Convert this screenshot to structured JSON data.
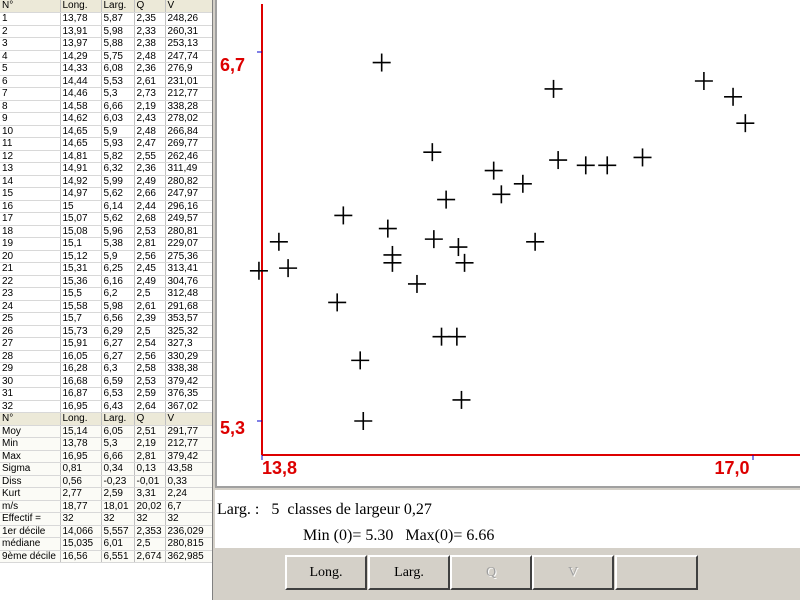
{
  "table": {
    "headers": [
      "N°",
      "Long.",
      "Larg.",
      "Q",
      "V"
    ],
    "rows": [
      [
        "1",
        "13,78",
        "5,87",
        "2,35",
        "248,26"
      ],
      [
        "2",
        "13,91",
        "5,98",
        "2,33",
        "260,31"
      ],
      [
        "3",
        "13,97",
        "5,88",
        "2,38",
        "253,13"
      ],
      [
        "4",
        "14,29",
        "5,75",
        "2,48",
        "247,74"
      ],
      [
        "5",
        "14,33",
        "6,08",
        "2,36",
        "276,9"
      ],
      [
        "6",
        "14,44",
        "5,53",
        "2,61",
        "231,01"
      ],
      [
        "7",
        "14,46",
        "5,3",
        "2,73",
        "212,77"
      ],
      [
        "8",
        "14,58",
        "6,66",
        "2,19",
        "338,28"
      ],
      [
        "9",
        "14,62",
        "6,03",
        "2,43",
        "278,02"
      ],
      [
        "10",
        "14,65",
        "5,9",
        "2,48",
        "266,84"
      ],
      [
        "11",
        "14,65",
        "5,93",
        "2,47",
        "269,77"
      ],
      [
        "12",
        "14,81",
        "5,82",
        "2,55",
        "262,46"
      ],
      [
        "13",
        "14,91",
        "6,32",
        "2,36",
        "311,49"
      ],
      [
        "14",
        "14,92",
        "5,99",
        "2,49",
        "280,82"
      ],
      [
        "15",
        "14,97",
        "5,62",
        "2,66",
        "247,97"
      ],
      [
        "16",
        "15",
        "6,14",
        "2,44",
        "296,16"
      ],
      [
        "17",
        "15,07",
        "5,62",
        "2,68",
        "249,57"
      ],
      [
        "18",
        "15,08",
        "5,96",
        "2,53",
        "280,81"
      ],
      [
        "19",
        "15,1",
        "5,38",
        "2,81",
        "229,07"
      ],
      [
        "20",
        "15,12",
        "5,9",
        "2,56",
        "275,36"
      ],
      [
        "21",
        "15,31",
        "6,25",
        "2,45",
        "313,41"
      ],
      [
        "22",
        "15,36",
        "6,16",
        "2,49",
        "304,76"
      ],
      [
        "23",
        "15,5",
        "6,2",
        "2,5",
        "312,48"
      ],
      [
        "24",
        "15,58",
        "5,98",
        "2,61",
        "291,68"
      ],
      [
        "25",
        "15,7",
        "6,56",
        "2,39",
        "353,57"
      ],
      [
        "26",
        "15,73",
        "6,29",
        "2,5",
        "325,32"
      ],
      [
        "27",
        "15,91",
        "6,27",
        "2,54",
        "327,3"
      ],
      [
        "28",
        "16,05",
        "6,27",
        "2,56",
        "330,29"
      ],
      [
        "29",
        "16,28",
        "6,3",
        "2,58",
        "338,38"
      ],
      [
        "30",
        "16,68",
        "6,59",
        "2,53",
        "379,42"
      ],
      [
        "31",
        "16,87",
        "6,53",
        "2,59",
        "376,35"
      ],
      [
        "32",
        "16,95",
        "6,43",
        "2,64",
        "367,02"
      ]
    ],
    "stats": [
      [
        "Moy",
        "15,14",
        "6,05",
        "2,51",
        "291,77"
      ],
      [
        "Min",
        "13,78",
        "5,3",
        "2,19",
        "212,77"
      ],
      [
        "Max",
        "16,95",
        "6,66",
        "2,81",
        "379,42"
      ],
      [
        "Sigma",
        "0,81",
        "0,34",
        "0,13",
        "43,58"
      ],
      [
        "Diss",
        "0,56",
        "-0,23",
        "-0,01",
        "0,33"
      ],
      [
        "Kurt",
        "2,77",
        "2,59",
        "3,31",
        "2,24"
      ],
      [
        "m/s",
        "18,77",
        "18,01",
        "20,02",
        "6,7"
      ],
      [
        "Effectif =",
        "32",
        "32",
        "32",
        "32"
      ],
      [
        "1er décile",
        "14,066",
        "5,557",
        "2,353",
        "236,029"
      ],
      [
        "médiane",
        "15,035",
        "6,01",
        "2,5",
        "280,815"
      ],
      [
        "9ème décile",
        "16,56",
        "6,551",
        "2,674",
        "362,985"
      ]
    ]
  },
  "chart_data": {
    "type": "scatter",
    "x_tick_labels": [
      "13,8",
      "17,0"
    ],
    "y_tick_labels": [
      "6,7",
      "5,3"
    ],
    "xlim": [
      13.8,
      17.0
    ],
    "ylim": [
      5.3,
      6.7
    ],
    "points": [
      [
        13.78,
        5.87
      ],
      [
        13.91,
        5.98
      ],
      [
        13.97,
        5.88
      ],
      [
        14.29,
        5.75
      ],
      [
        14.33,
        6.08
      ],
      [
        14.44,
        5.53
      ],
      [
        14.46,
        5.3
      ],
      [
        14.58,
        6.66
      ],
      [
        14.62,
        6.03
      ],
      [
        14.65,
        5.9
      ],
      [
        14.65,
        5.93
      ],
      [
        14.81,
        5.82
      ],
      [
        14.91,
        6.32
      ],
      [
        14.92,
        5.99
      ],
      [
        14.97,
        5.62
      ],
      [
        15.0,
        6.14
      ],
      [
        15.07,
        5.62
      ],
      [
        15.08,
        5.96
      ],
      [
        15.1,
        5.38
      ],
      [
        15.12,
        5.9
      ],
      [
        15.31,
        6.25
      ],
      [
        15.36,
        6.16
      ],
      [
        15.5,
        6.2
      ],
      [
        15.58,
        5.98
      ],
      [
        15.7,
        6.56
      ],
      [
        15.73,
        6.29
      ],
      [
        15.91,
        6.27
      ],
      [
        16.05,
        6.27
      ],
      [
        16.28,
        6.3
      ],
      [
        16.68,
        6.59
      ],
      [
        16.87,
        6.53
      ],
      [
        16.95,
        6.43
      ]
    ],
    "colors": {
      "axis": "#dd0000",
      "marker": "#000000",
      "tick": "#0000cc"
    }
  },
  "info": {
    "line1": "Larg. :   5  classes de largeur 0,27",
    "line2": "Min (0)= 5.30   Max(0)= 6.66"
  },
  "buttons": {
    "long_label": "Long.",
    "larg_label": "Larg.",
    "q_label": "Q",
    "v_label": "V"
  }
}
